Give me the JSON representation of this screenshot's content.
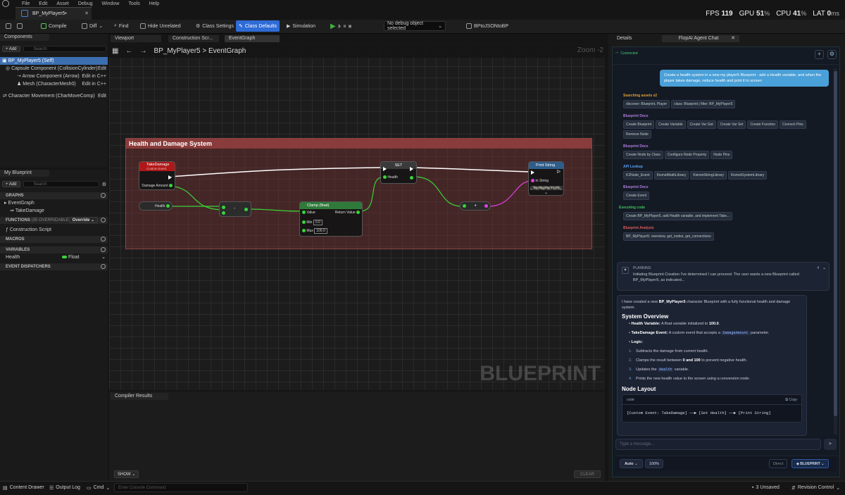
{
  "menu": [
    "File",
    "Edit",
    "Asset",
    "Debug",
    "Window",
    "Tools",
    "Help"
  ],
  "doc_tab": "BP_MyPlayer5•",
  "stats": {
    "fps_label": "FPS",
    "fps": "119",
    "gpu_label": "GPU",
    "gpu": "51",
    "cpu_label": "CPU",
    "cpu": "41",
    "lat_label": "LAT",
    "lat": "0",
    "pct": "%",
    "ms": "ms"
  },
  "toolbar": {
    "compile": "Compile",
    "diff": "Diff",
    "find": "Find",
    "hide_unrelated": "Hide Unrelated",
    "class_settings": "Class Settings",
    "class_defaults": "Class Defaults",
    "simulation": "Simulation",
    "debug_select": "No debug object selected",
    "bp_to_json": "BPtoJSONtoBP"
  },
  "components": {
    "tab": "Components",
    "add": "Add",
    "search_placeholder": "Search",
    "items": [
      "BP_MyPlayer5 (Self)",
      "Capsule Component (CollisionCylinder)",
      "Arrow Component (Arrow)",
      "Mesh (CharacterMesh0)",
      "Character Movement (CharMoveComp)"
    ],
    "edit": "Edit",
    "edit_cpp": "Edit in C++"
  },
  "my_blueprint": {
    "tab": "My Blueprint",
    "add": "Add",
    "search_placeholder": "Search",
    "graphs": "GRAPHS",
    "event_graph": "EventGraph",
    "take_damage": "TakeDamage",
    "functions": "FUNCTIONS",
    "functions_count": "(35 OVERRIDABLE)",
    "override": "Override",
    "construction_script": "Construction Script",
    "macros": "MACROS",
    "variables": "VARIABLES",
    "var_name": "Health",
    "var_type": "Float",
    "dispatchers": "EVENT DISPATCHERS"
  },
  "graph_tabs": [
    "Viewport",
    "Construction Scr...",
    "EventGraph"
  ],
  "breadcrumb": {
    "bp": "BP_MyPlayer5",
    "sep": ">",
    "graph": "EventGraph"
  },
  "zoom": "Zoom -2",
  "watermark": "BLUEPRINT",
  "comment_title": "Health and Damage System",
  "nodes": {
    "take_damage": {
      "title": "TakeDamage",
      "subtitle": "Custom Event",
      "pin": "Damage Amount"
    },
    "health": "Health",
    "subtract": "-",
    "clamp": {
      "title": "Clamp (float)",
      "value": "Value",
      "ret": "Return Value",
      "min": "Min",
      "min_val": "0.0",
      "max": "Max",
      "max_val": "100.0"
    },
    "set": {
      "title": "SET",
      "pin": "Health"
    },
    "conv": "•",
    "print": {
      "title": "Print String",
      "pin": "In String",
      "dev": "Development Only"
    }
  },
  "compiler": {
    "tab": "Compiler Results",
    "show": "SHOW",
    "clear": "CLEAR"
  },
  "right_tabs": [
    "Details",
    "FlopAI Agent Chat"
  ],
  "chat": {
    "status": "Connected",
    "user_msg": "Create a health system in a new my player5 Blueprint - add a Health variable, and when the player takes damage, reduce health and print it to screen",
    "sections": [
      {
        "title": "Searching assets x2",
        "color": "#e0a030",
        "chips": [
          "discover: Blueprint, Player",
          "class: Blueprint | filter: BP_MyPlayer5"
        ]
      },
      {
        "title": "Blueprint Docs",
        "color": "#b07be0",
        "chips": [
          "Create Blueprint",
          "Create Variable",
          "Create Var Get",
          "Create Var Set",
          "Create Function",
          "Connect Pins",
          "Remove Node"
        ]
      },
      {
        "title": "Blueprint Docs",
        "color": "#b07be0",
        "chips": [
          "Create Node by Class",
          "Configure Node Property",
          "Node Pins"
        ]
      },
      {
        "title": "API Lookup",
        "color": "#5aa0f0",
        "chips": [
          "K2Node_Event",
          "KismetMathLibrary",
          "KismetStringLibrary",
          "KismetSystemLibrary"
        ]
      },
      {
        "title": "Blueprint Docs",
        "color": "#b07be0",
        "chips": [
          "Create Event"
        ]
      },
      {
        "title": "Executing code",
        "color": "#40c060",
        "chips": [
          "Create BP_MyPlayer5, add Health variable, and implement Take..."
        ]
      },
      {
        "title": "Blueprint Analysis",
        "color": "#e05a5a",
        "chips": [
          "BP_MyPlayer5: overview, get_nodes, get_connections"
        ]
      }
    ],
    "planning_label": "PLANNING",
    "planning_count": "4",
    "planning_text": "Initiating Blueprint Creation I've determined I can proceed. The user wants a new Blueprint called BP_MyPlayer5, as indicated...",
    "resp_intro_1": "I have created a new ",
    "resp_intro_bold": "BP_MyPlayer5",
    "resp_intro_2": " character Blueprint with a fully functional health and damage system.",
    "overview_title": "System Overview",
    "b1_bold": "Health Variable:",
    "b1_text": " A float variable initialized to ",
    "b1_val": "100.0",
    "b1_end": ".",
    "b2_bold": "TakeDamage Event:",
    "b2_text": " A custom event that accepts a ",
    "b2_code": "DamageAmount",
    "b2_end": " parameter.",
    "b3_bold": "Logic:",
    "steps": [
      {
        "n": "1.",
        "text": "Subtracts the damage from current health."
      },
      {
        "n": "2.",
        "text": "Clamps the result between ",
        "bold": "0 and 100",
        "end": " to prevent negative health."
      },
      {
        "n": "3.",
        "text": "Updates the ",
        "code": "Health",
        "end": " variable."
      },
      {
        "n": "4.",
        "text": "Prints the new health value to the screen using a conversion node."
      }
    ],
    "layout_title": "Node Layout",
    "code_label": "code",
    "copy": "Copy",
    "code_line": "[Custom Event: TakeDamage] ──▶ [Set Health] ──▶ [Print String]",
    "input_placeholder": "Type a message...",
    "mode": "Auto",
    "percent": "100%",
    "direct": "Direct",
    "blueprint": "BLUEPRINT"
  },
  "status_bar": {
    "content_drawer": "Content Drawer",
    "output_log": "Output Log",
    "cmd": "Cmd",
    "console_placeholder": "Enter Console Command",
    "unsaved": "3 Unsaved",
    "revision": "Revision Control"
  }
}
